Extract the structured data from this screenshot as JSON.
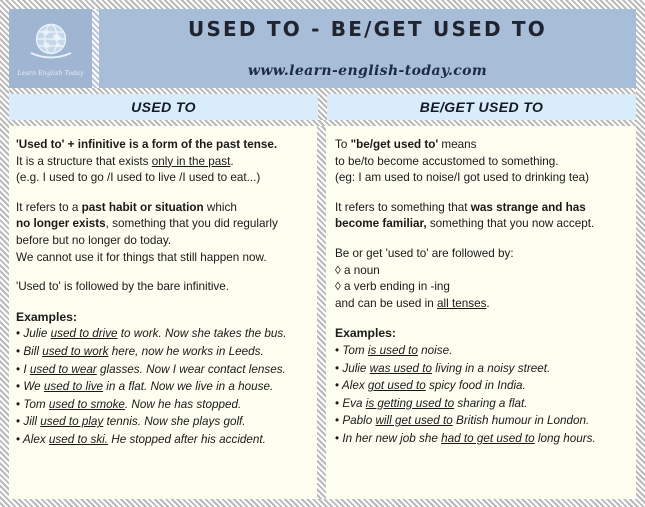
{
  "header": {
    "title": "USED TO - BE/GET USED TO",
    "url": "www.learn-english-today.com",
    "logo_name": "globe-icon",
    "logo_caption": "Learn English Today",
    "bg_color": "#a8bdd8",
    "title_color": "#20242e"
  },
  "columns": {
    "left_title": "USED TO",
    "right_title": "BE/GET USED TO",
    "header_bg": "#d9ecf9",
    "body_bg": "#fdfdf0"
  },
  "left": {
    "block1": {
      "l1_a": "'Used to' + infinitive is a form of the past tense.",
      "l2_a": " It is a structure that exists ",
      "l2_u": "only in the past",
      "l2_b": ".",
      "l3": "(e.g. I used to go /I used to live /I used to eat...)"
    },
    "block2": {
      "l1_a": "It refers to a ",
      "l1_b": "past habit or situation",
      "l1_c": " which",
      "l2_b": "no longer exists",
      "l2_c": ", something that you did regularly",
      "l3": "before but no longer do today.",
      "l4": "We cannot use it for things that still happen now."
    },
    "block3": {
      "l1": "'Used to' is followed by the bare infinitive."
    },
    "examples_label": "Examples:",
    "examples": [
      {
        "pre": "Julie ",
        "u": "used to drive",
        "post": " to work. Now she takes the bus."
      },
      {
        "pre": "Bill ",
        "u": "used to work",
        "post": " here,  now he works in Leeds."
      },
      {
        "pre": "I ",
        "u": "used to wear",
        "post": " glasses. Now I wear contact lenses."
      },
      {
        "pre": "We ",
        "u": "used to live",
        "post": " in a flat.  Now we live in a house."
      },
      {
        "pre": "Tom ",
        "u": "used to smoke",
        "post": ". Now he has stopped."
      },
      {
        "pre": "Jill ",
        "u": "used to play",
        "post": " tennis.  Now she plays golf."
      },
      {
        "pre": "Alex ",
        "u": "used to ski.",
        "post": "  He stopped after his accident."
      }
    ]
  },
  "right": {
    "block1": {
      "l1_a": "To ",
      "l1_b": "\"be/get used to'",
      "l1_c": " means",
      "l2": "to be/to become accustomed to something.",
      "l3": "(eg: I am used to noise/I got used to drinking tea)"
    },
    "block2": {
      "l1_a": "It refers to something that ",
      "l1_b": "was strange and has",
      "l2_b": "become familiar,",
      "l2_c": " something that you now accept."
    },
    "block3": {
      "l1": "Be or get 'used to' are followed by:",
      "bullet_glyph": "◊",
      "b1": " a noun",
      "b2": " a verb ending in -ing",
      "l4_a": "and can be used in ",
      "l4_u": "all tenses",
      "l4_b": "."
    },
    "examples_label": "Examples:",
    "examples": [
      {
        "pre": "Tom ",
        "u": "is used to",
        "post": " noise."
      },
      {
        "pre": "Julie ",
        "u": "was used to",
        "post": " living in a noisy street."
      },
      {
        "pre": "Alex ",
        "u": "got used to",
        "post": " spicy food in India."
      },
      {
        "pre": "Eva ",
        "u": "is getting used to",
        "post": " sharing a flat."
      },
      {
        "pre": "Pablo ",
        "u": "will get used to",
        "post": " British humour in London."
      },
      {
        "pre": "In her new job she ",
        "u": "had to get used to",
        "post": " long hours."
      }
    ]
  },
  "bullet": "•"
}
